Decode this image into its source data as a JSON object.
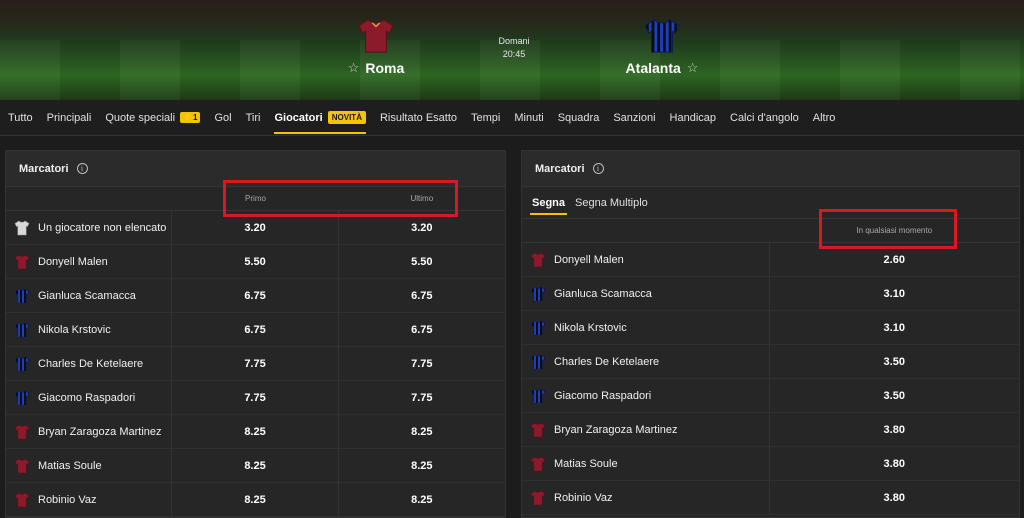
{
  "colors": {
    "accent": "#f5c400",
    "highlight": "#d71920",
    "roma": "#8b1a2b",
    "atalanta": "#1c3fbf"
  },
  "match": {
    "home": {
      "name": "Roma",
      "jersey": "roma-jersey"
    },
    "away": {
      "name": "Atalanta",
      "jersey": "atalanta-jersey"
    },
    "day": "Domani",
    "time": "20:45"
  },
  "tabs": [
    {
      "label": "Tutto"
    },
    {
      "label": "Principali"
    },
    {
      "label": "Quote speciali",
      "badge": "⚡1"
    },
    {
      "label": "Gol"
    },
    {
      "label": "Tiri"
    },
    {
      "label": "Giocatori",
      "badge": "NOVITÀ",
      "active": true
    },
    {
      "label": "Risultato Esatto"
    },
    {
      "label": "Tempi"
    },
    {
      "label": "Minuti"
    },
    {
      "label": "Squadra"
    },
    {
      "label": "Sanzioni"
    },
    {
      "label": "Handicap"
    },
    {
      "label": "Calci d'angolo"
    },
    {
      "label": "Altro"
    }
  ],
  "left_panel": {
    "title": "Marcatori",
    "col_first": "Primo",
    "col_last": "Ultimo",
    "rows": [
      {
        "name": "Un giocatore non elencato",
        "team": "none",
        "first": "3.20",
        "last": "3.20"
      },
      {
        "name": "Donyell Malen",
        "team": "roma",
        "first": "5.50",
        "last": "5.50"
      },
      {
        "name": "Gianluca Scamacca",
        "team": "atalanta",
        "first": "6.75",
        "last": "6.75"
      },
      {
        "name": "Nikola Krstovic",
        "team": "atalanta",
        "first": "6.75",
        "last": "6.75"
      },
      {
        "name": "Charles De Ketelaere",
        "team": "atalanta",
        "first": "7.75",
        "last": "7.75"
      },
      {
        "name": "Giacomo Raspadori",
        "team": "atalanta",
        "first": "7.75",
        "last": "7.75"
      },
      {
        "name": "Bryan Zaragoza Martinez",
        "team": "roma",
        "first": "8.25",
        "last": "8.25"
      },
      {
        "name": "Matias Soule",
        "team": "roma",
        "first": "8.25",
        "last": "8.25"
      },
      {
        "name": "Robinio Vaz",
        "team": "roma",
        "first": "8.25",
        "last": "8.25"
      }
    ]
  },
  "right_panel": {
    "title": "Marcatori",
    "subtabs": [
      {
        "label": "Segna",
        "active": true
      },
      {
        "label": "Segna Multiplo"
      }
    ],
    "col_any": "In qualsiasi momento",
    "rows": [
      {
        "name": "Donyell Malen",
        "team": "roma",
        "any": "2.60"
      },
      {
        "name": "Gianluca Scamacca",
        "team": "atalanta",
        "any": "3.10"
      },
      {
        "name": "Nikola Krstovic",
        "team": "atalanta",
        "any": "3.10"
      },
      {
        "name": "Charles De Ketelaere",
        "team": "atalanta",
        "any": "3.50"
      },
      {
        "name": "Giacomo Raspadori",
        "team": "atalanta",
        "any": "3.50"
      },
      {
        "name": "Bryan Zaragoza Martinez",
        "team": "roma",
        "any": "3.80"
      },
      {
        "name": "Matias Soule",
        "team": "roma",
        "any": "3.80"
      },
      {
        "name": "Robinio Vaz",
        "team": "roma",
        "any": "3.80"
      }
    ]
  }
}
